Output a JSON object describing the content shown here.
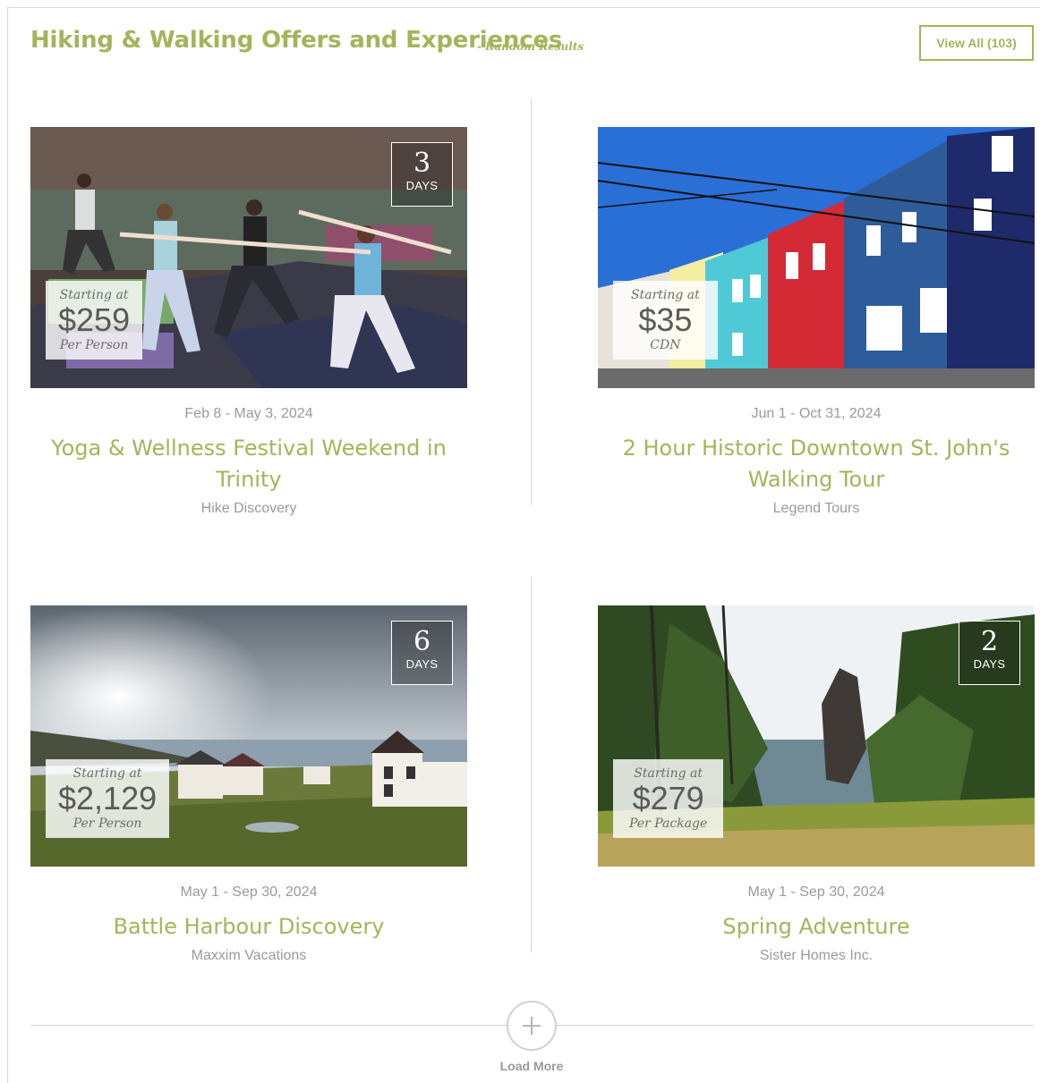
{
  "header": {
    "title": "Hiking & Walking Offers and Experiences",
    "note": "- Random Results",
    "view_all": "View All (103)"
  },
  "cards": [
    {
      "days_number": "3",
      "days_label": "DAYS",
      "price_prefix": "Starting at",
      "price": "$259",
      "price_unit": "Per Person",
      "dates": "Feb 8 - May 3, 2024",
      "title": "Yoga & Wellness Festival Weekend in Trinity",
      "vendor": "Hike Discovery"
    },
    {
      "price_prefix": "Starting at",
      "price": "$35",
      "price_unit": "CDN",
      "dates": "Jun 1 - Oct 31, 2024",
      "title": "2 Hour Historic Downtown St. John's Walking Tour",
      "vendor": "Legend Tours"
    },
    {
      "days_number": "6",
      "days_label": "DAYS",
      "price_prefix": "Starting at",
      "price": "$2,129",
      "price_unit": "Per Person",
      "dates": "May 1 - Sep 30, 2024",
      "title": "Battle Harbour Discovery",
      "vendor": "Maxxim Vacations"
    },
    {
      "days_number": "2",
      "days_label": "DAYS",
      "price_prefix": "Starting at",
      "price": "$279",
      "price_unit": "Per Package",
      "dates": "May 1 - Sep 30, 2024",
      "title": "Spring Adventure",
      "vendor": "Sister Homes Inc."
    }
  ],
  "load_more": {
    "icon": "plus-icon",
    "label": "Load More"
  },
  "colors": {
    "accent": "#a3b55a",
    "muted_text": "#9a9a9a"
  }
}
